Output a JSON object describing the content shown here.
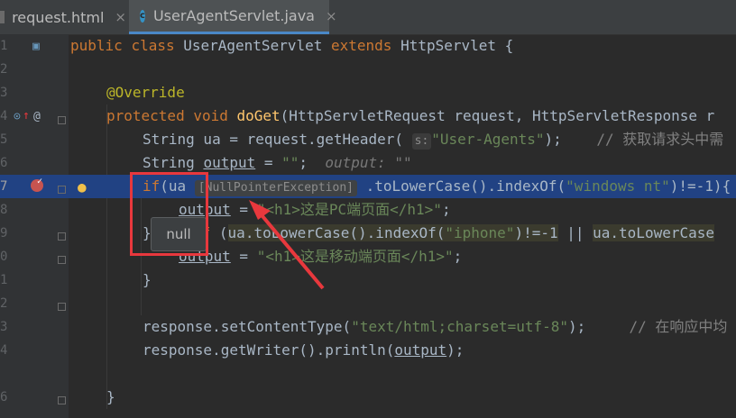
{
  "tabs": [
    {
      "label": "request.html",
      "close": "×"
    },
    {
      "label": "UserAgentServlet.java",
      "close": "×",
      "icon_letter": "c"
    }
  ],
  "line_numbers": [
    "1",
    "2",
    "3",
    "4",
    "5",
    "6",
    "7",
    "8",
    "9",
    "0",
    "1",
    "2",
    "3",
    "4",
    "6"
  ],
  "code": {
    "l1": {
      "kw1": "public ",
      "kw2": "class ",
      "name": "UserAgentServlet ",
      "kw3": "extends ",
      "rest": "HttpServlet {"
    },
    "l3": {
      "ann": "@Override"
    },
    "l4": {
      "kw1": "protected ",
      "kw2": "void ",
      "fn": "doGet",
      "rest": "(HttpServletRequest request, HttpServletResponse r"
    },
    "l5": {
      "a": "String ua = request.getHeader( ",
      "hint": "s:",
      "str": "\"User-Agents\"",
      "b": ");",
      "cm": "    // 获取请求头中需"
    },
    "l6": {
      "a": "String ",
      "var": "output",
      "b": " = ",
      "str": "\"\"",
      "c": ";  ",
      "hint": "output: \"\""
    },
    "l7": {
      "kw": "if",
      "a": "(ua ",
      "inlay": "[NullPointerException]",
      "b": " .toLowerCase().indexOf(",
      "str": "\"windows nt\"",
      "c": ")!=-1){"
    },
    "l8": {
      "var": "output",
      "a": " = ",
      "str": "\"<h1>这是PC端页面</h1>\"",
      "b": ";"
    },
    "l9": {
      "a": "}",
      "kw": "f ",
      "b": "(",
      "w1": "ua.toLowerCase().indexOf(",
      "str": "\"iphone\"",
      "c": ")!=-1",
      "d": " || ",
      "w2": "ua.toLowerCase"
    },
    "l10": {
      "var": "output",
      "a": " = ",
      "str": "\"<h1>这是移动端页面</h1>\"",
      "b": ";"
    },
    "l11": {
      "a": "}"
    },
    "l13": {
      "a": "response.setContentType(",
      "str": "\"text/html;charset=utf-8\"",
      "b": ");",
      "cm": "     // 在响应中均"
    },
    "l14": {
      "a": "response.getWriter().println(",
      "var": "output",
      "b": ");"
    },
    "l15": {
      "a": "}"
    }
  },
  "tooltip": {
    "text": "null"
  },
  "colors": {
    "highlight": "#214283",
    "annotation_box": "#e8383d",
    "arrow": "#e8383d"
  }
}
